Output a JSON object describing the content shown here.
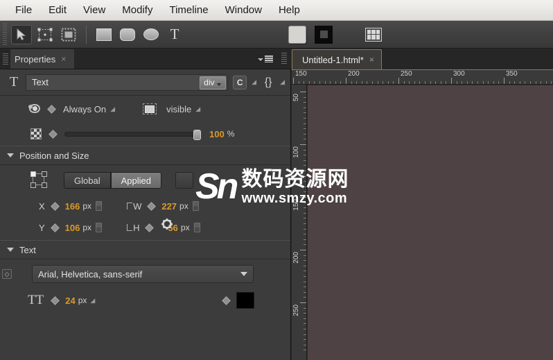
{
  "menu": {
    "items": [
      "File",
      "Edit",
      "View",
      "Modify",
      "Timeline",
      "Window",
      "Help"
    ]
  },
  "toolbar": {
    "tools": [
      {
        "name": "selection-tool",
        "icon": "arrow-cursor-icon",
        "selected": true
      },
      {
        "name": "transform-tool",
        "icon": "transform-box-icon",
        "selected": false
      },
      {
        "name": "clipping-tool",
        "icon": "marquee-icon",
        "selected": false
      }
    ],
    "shapes": [
      {
        "name": "rectangle-tool",
        "icon": "square-icon"
      },
      {
        "name": "rounded-rectangle-tool",
        "icon": "rounded-square-icon"
      },
      {
        "name": "ellipse-tool",
        "icon": "ellipse-icon"
      },
      {
        "name": "text-tool",
        "icon": "text-T-icon",
        "label": "T"
      }
    ],
    "fill_color": "#d6d4d0",
    "stroke_color": "#0a0a0a",
    "layout_icon": "grid-table-icon"
  },
  "properties": {
    "tab_label": "Properties",
    "tab_close": "×",
    "element": {
      "type_icon": "text-T-icon",
      "name_value": "Text",
      "tag_label": "div",
      "class_icon_label": "C",
      "code_icon_label": "{}"
    },
    "display": {
      "eye_icon": "eye-icon",
      "always_on_label": "Always On",
      "visibility_icon": "visibility-box-icon",
      "visible_label": "visible"
    },
    "opacity": {
      "icon": "checkerboard-opacity-icon",
      "value": "100",
      "unit": "%",
      "slider_percent": 100
    },
    "position_and_size": {
      "section_title": "Position and Size",
      "anchor_icon": "anchor-point-grid-icon",
      "global_label": "Global",
      "applied_label": "Applied",
      "lock_icon": "lock-button-icon",
      "x_label": "X",
      "x_value": "166",
      "x_unit": "px",
      "y_label": "Y",
      "y_value": "106",
      "y_unit": "px",
      "w_label": "W",
      "w_value": "227",
      "w_unit": "px",
      "h_label": "H",
      "h_value": "56",
      "h_unit": "px",
      "link_icon": "link-constrain-icon",
      "expand_icon": "expand-chevron-icon"
    },
    "text": {
      "section_title": "Text",
      "font_family": "Arial, Helvetica, sans-serif",
      "font_size_icon": "font-size-TT-icon",
      "font_size_value": "24",
      "font_size_unit": "px",
      "color_swatch": "#000000"
    }
  },
  "document": {
    "tab_title": "Untitled-1.html*",
    "tab_close": "×",
    "ruler_top_labels": [
      "150",
      "200",
      "250",
      "300",
      "350"
    ],
    "ruler_left_labels": [
      "50",
      "100",
      "150",
      "200",
      "250"
    ],
    "canvas_color": "#4e4245"
  },
  "watermark": {
    "logo_text": "Sn",
    "site_name_cn": "数码资源网",
    "site_url": "www.smzy.com"
  }
}
